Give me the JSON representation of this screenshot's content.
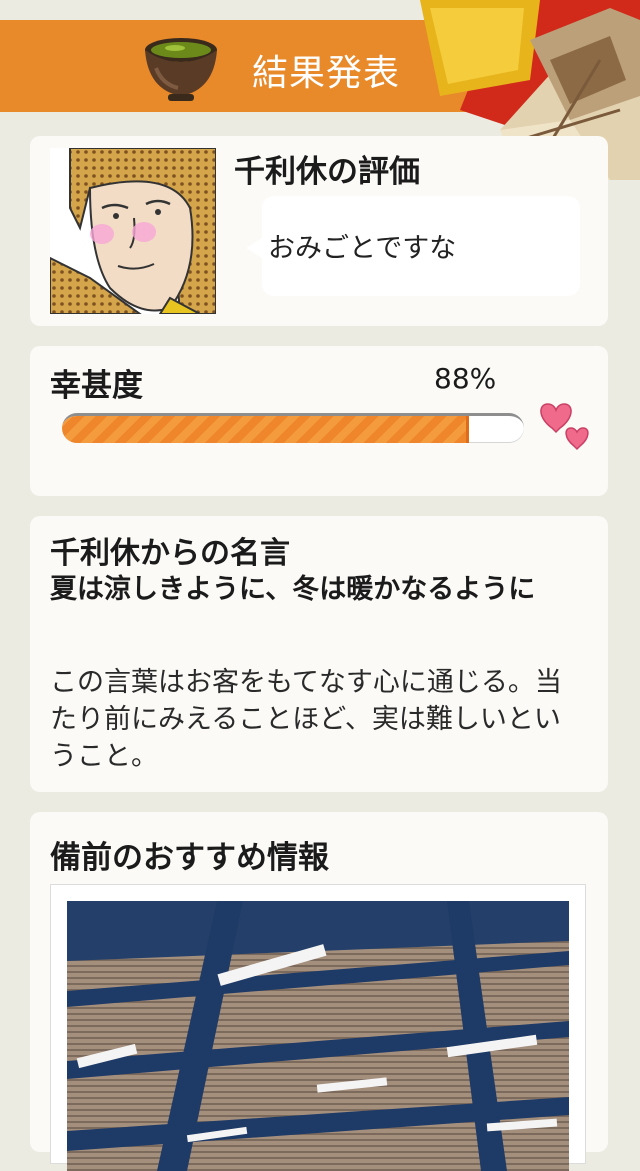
{
  "header": {
    "title": "結果発表"
  },
  "evaluation": {
    "title": "千利休の評価",
    "comment": "おみごとですな"
  },
  "happiness": {
    "label": "幸甚度",
    "percent_text": "88%",
    "value_fraction": 0.88
  },
  "quote": {
    "title": "千利休からの名言",
    "main": "夏は涼しきように、冬は暖かなるように",
    "body": "この言葉はお客をもてなす心に通じる。当たり前にみえることほど、実は難しいということ。"
  },
  "info": {
    "title": "備前のおすすめ情報"
  },
  "colors": {
    "header": "#e8892a",
    "bar_fill": "#f49b3e",
    "background": "#ecebe2"
  }
}
